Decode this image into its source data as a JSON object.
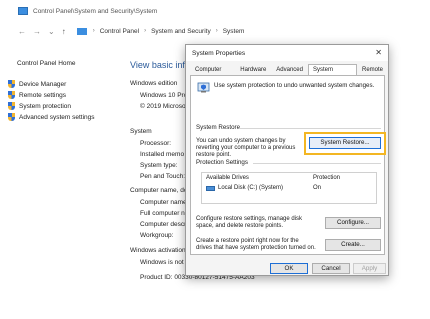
{
  "window": {
    "title": "Control Panel\\System and Security\\System"
  },
  "address": {
    "back_icon": "←",
    "forward_icon": "→",
    "dropdown_icon": "⌄",
    "up_icon": "↑",
    "crumbs": [
      "Control Panel",
      "System and Security",
      "System"
    ],
    "separator": "›"
  },
  "sidebar": {
    "home": "Control Panel Home",
    "items": [
      {
        "label": "Device Manager"
      },
      {
        "label": "Remote settings"
      },
      {
        "label": "System protection"
      },
      {
        "label": "Advanced system settings"
      }
    ]
  },
  "main": {
    "title": "View basic info",
    "windows_edition": "Windows edition",
    "edition_rows": [
      "Windows 10 Pro",
      "© 2019 Microso"
    ],
    "system_head": "System",
    "system_rows": [
      "Processor:",
      "Installed memo",
      "System type:",
      "Pen and Touch:"
    ],
    "computer_head": "Computer name, do",
    "computer_rows": [
      "Computer name",
      "Full computer n",
      "Computer descri",
      "Workgroup:"
    ],
    "activation_head": "Windows activation",
    "activation_rows": [
      "Windows is not",
      "Product ID: 00330-80127-51475-AA203"
    ]
  },
  "dialog": {
    "title": "System Properties",
    "close_label": "✕",
    "tabs": [
      "Computer Name",
      "Hardware",
      "Advanced",
      "System Protection",
      "Remote"
    ],
    "active_tab": 3,
    "intro": "Use system protection to undo unwanted system changes.",
    "restore_group": "System Restore",
    "restore_text": "You can undo system changes by reverting your computer to a previous restore point.",
    "restore_button": "System Restore...",
    "settings_group": "Protection Settings",
    "drives_header": {
      "drive": "Available Drives",
      "protection": "Protection"
    },
    "drives": [
      {
        "name": "Local Disk (C:) (System)",
        "protection": "On"
      }
    ],
    "configure_text": "Configure restore settings, manage disk space, and delete restore points.",
    "configure_button": "Configure...",
    "create_text": "Create a restore point right now for the drives that have system protection turned on.",
    "create_button": "Create...",
    "ok_button": "OK",
    "cancel_button": "Cancel",
    "apply_button": "Apply"
  },
  "colors": {
    "highlight": "#f3b623",
    "link": "#2a5a9a"
  }
}
